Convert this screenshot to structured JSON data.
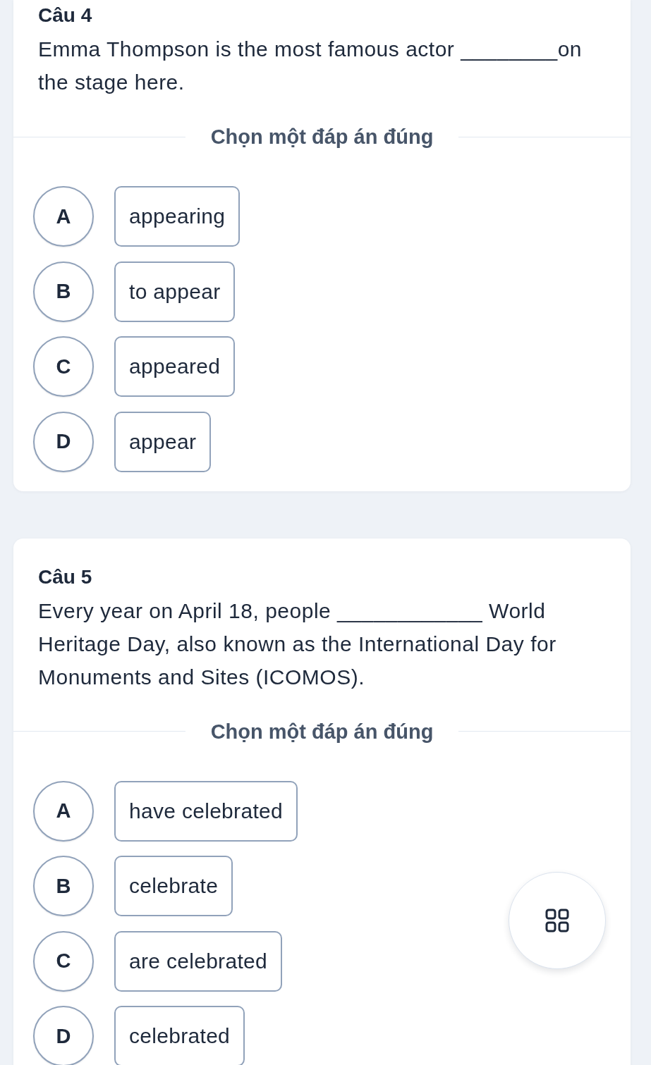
{
  "questions": [
    {
      "title": "Câu 4",
      "text": "Emma Thompson is the most famous actor ________on the stage here.",
      "prompt": "Chọn một đáp án đúng",
      "options": [
        {
          "letter": "A",
          "text": "appearing",
          "selected": false
        },
        {
          "letter": "B",
          "text": "to appear",
          "selected": false
        },
        {
          "letter": "C",
          "text": "appeared",
          "selected": false
        },
        {
          "letter": "D",
          "text": "appear",
          "selected": false
        }
      ]
    },
    {
      "title": "Câu 5",
      "text": "Every year on April 18, people ____________ World Heritage Day, also known as the International Day for Monuments and Sites (ICOMOS).",
      "prompt": "Chọn một đáp án đúng",
      "options": [
        {
          "letter": "A",
          "text": "have celebrated",
          "selected": false
        },
        {
          "letter": "B",
          "text": "celebrate",
          "selected": false
        },
        {
          "letter": "C",
          "text": "are celebrated",
          "selected": false
        },
        {
          "letter": "D",
          "text": "celebrated",
          "selected": false
        }
      ]
    }
  ]
}
